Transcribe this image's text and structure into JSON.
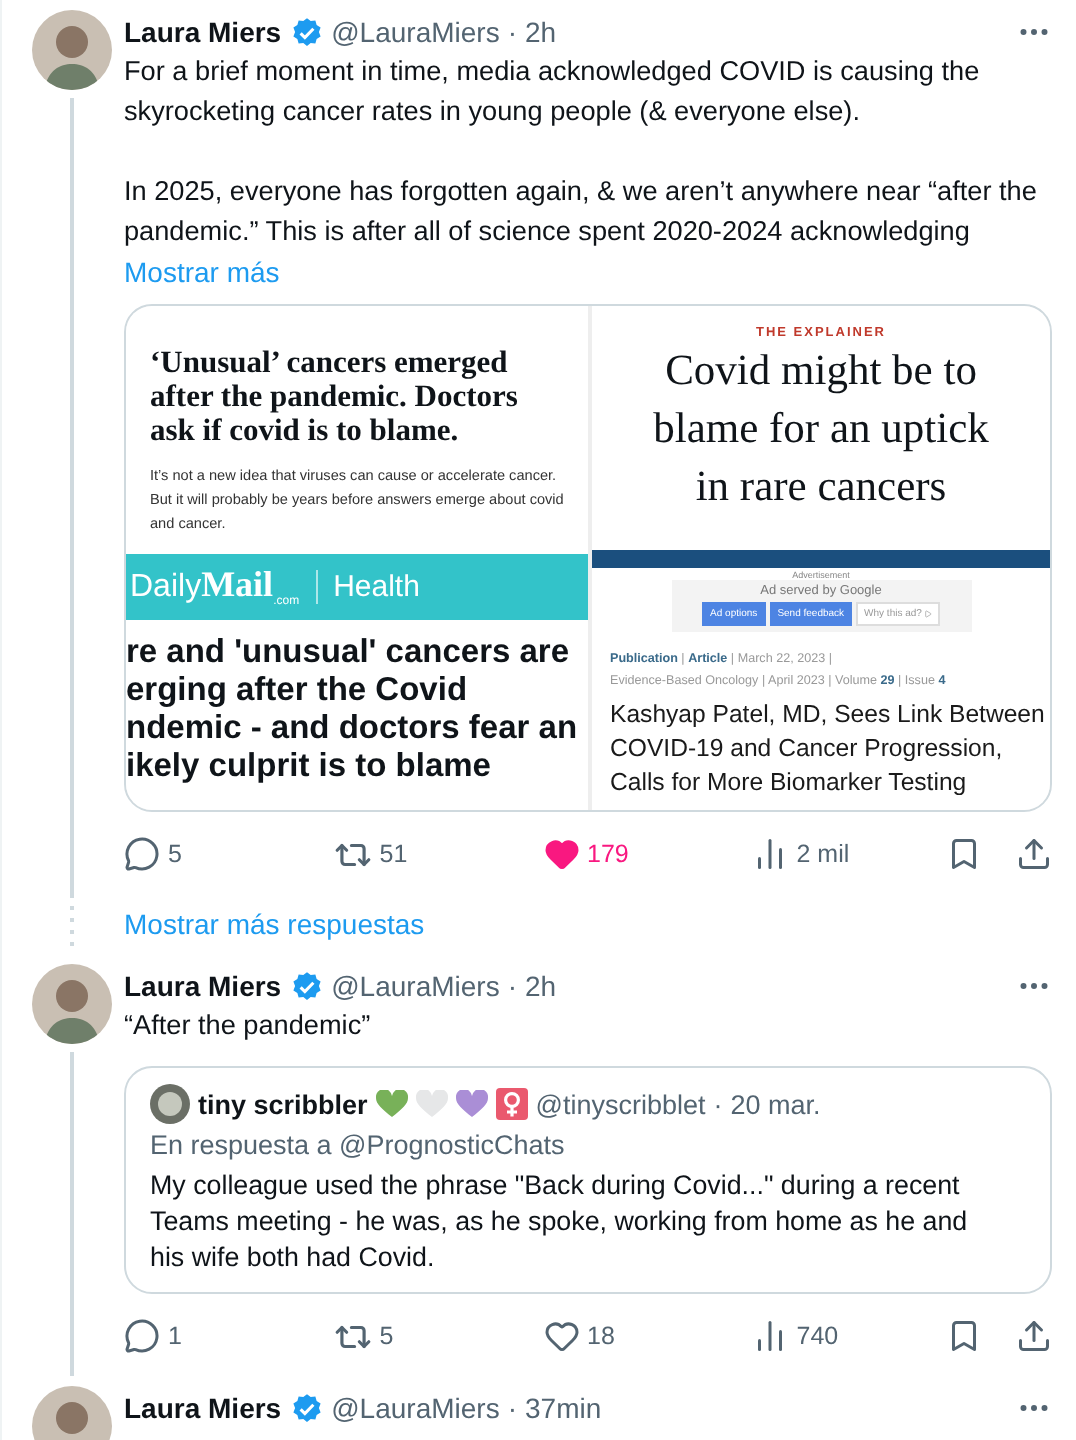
{
  "tweets": [
    {
      "author": "Laura Miers",
      "verified": true,
      "handle": "@LauraMiers",
      "separator": "·",
      "time": "2h",
      "text": [
        "For a brief moment in time, media acknowledged COVID is causing the skyrocketing cancer rates in young people (& everyone else).",
        "In 2025, everyone has forgotten again, & we aren’t anywhere near “after the pandemic.” This is after all of science spent 2020-2024 acknowledging"
      ],
      "show_more": "Mostrar más",
      "media": {
        "left": {
          "headline": [
            "‘Unusual’ cancers emerged",
            "after the pandemic. Doctors",
            "ask if covid is to blame."
          ],
          "dek": "It’s not a new idea that viruses can cause or accelerate cancer. But it will probably be years before answers emerge about covid and cancer.",
          "brand": "Daily",
          "brand_bold": "Mail",
          "brand_sub": ".com",
          "section": "Health",
          "story": [
            "re and 'unusual' cancers are",
            "erging after the Covid",
            "ndemic - and doctors fear an",
            "ikely culprit is to blame"
          ]
        },
        "right": {
          "kicker": "THE EXPLAINER",
          "headline": [
            "Covid might be to",
            "blame for an uptick",
            "in rare cancers"
          ],
          "ad_label": "Advertisement",
          "ad_served": "Ad served by Google",
          "ad_buttons": [
            "Ad options",
            "Send feedback",
            "Why this ad?"
          ],
          "meta": [
            "**Publication** | **Article** | March 22, 2023 |",
            "Evidence-Based Oncology | April 2023 | Volume **29** | Issue **4**"
          ],
          "title": [
            "Kashyap Patel, MD, Sees Link Between",
            "COVID-19 and Cancer Progression,",
            "Calls for More Biomarker Testing"
          ]
        }
      },
      "actions": {
        "replies": "5",
        "reposts": "51",
        "likes": "179",
        "liked": true,
        "views": "2 mil"
      }
    },
    {
      "kind": "link",
      "label": "Mostrar más respuestas"
    },
    {
      "author": "Laura Miers",
      "verified": true,
      "handle": "@LauraMiers",
      "separator": "·",
      "time": "2h",
      "text": [
        "“After the pandemic”"
      ],
      "quote": {
        "author": "tiny scribbler",
        "badges": [
          {
            "kind": "heart",
            "color": "#78b159"
          },
          {
            "kind": "heart",
            "color": "#e6e7e8"
          },
          {
            "kind": "heart",
            "color": "#aa8ed6"
          },
          {
            "kind": "female",
            "color": "#ea596e"
          }
        ],
        "handle": "@tinyscribblet",
        "separator": "·",
        "time": "20 mar.",
        "reply_to": "En respuesta a @PrognosticChats",
        "text": "My colleague used the phrase \"Back during Covid...\" during a recent Teams meeting - he was, as he spoke, working from home as he and his wife both had Covid."
      },
      "actions": {
        "replies": "1",
        "reposts": "5",
        "likes": "18",
        "liked": false,
        "views": "740"
      }
    },
    {
      "author": "Laura Miers",
      "verified": true,
      "handle": "@LauraMiers",
      "separator": "·",
      "time": "37min"
    }
  ]
}
